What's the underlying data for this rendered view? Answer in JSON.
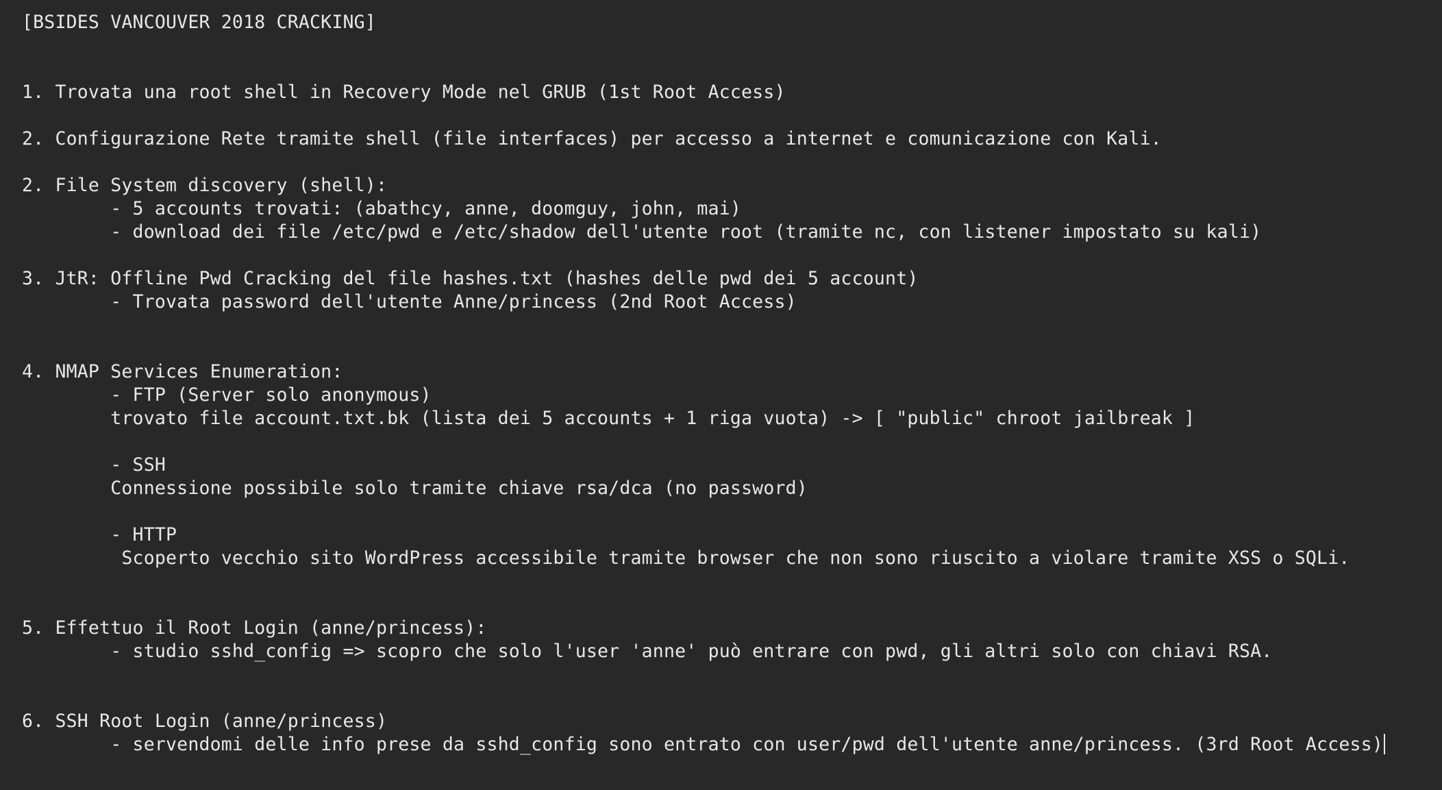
{
  "document": {
    "lines": [
      "[BSIDES VANCOUVER 2018 CRACKING]",
      "",
      "",
      "1. Trovata una root shell in Recovery Mode nel GRUB (1st Root Access)",
      "",
      "2. Configurazione Rete tramite shell (file interfaces) per accesso a internet e comunicazione con Kali.",
      "",
      "2. File System discovery (shell):",
      "        - 5 accounts trovati: (abathcy, anne, doomguy, john, mai)",
      "        - download dei file /etc/pwd e /etc/shadow dell'utente root (tramite nc, con listener impostato su kali)",
      "",
      "3. JtR: Offline Pwd Cracking del file hashes.txt (hashes delle pwd dei 5 account)",
      "        - Trovata password dell'utente Anne/princess (2nd Root Access)",
      "",
      "",
      "4. NMAP Services Enumeration:",
      "        - FTP (Server solo anonymous)",
      "        trovato file account.txt.bk (lista dei 5 accounts + 1 riga vuota) -> [ \"public\" chroot jailbreak ]",
      "",
      "        - SSH",
      "        Connessione possibile solo tramite chiave rsa/dca (no password)",
      "",
      "        - HTTP",
      "         Scoperto vecchio sito WordPress accessibile tramite browser che non sono riuscito a violare tramite XSS o SQLi.",
      "",
      "",
      "5. Effettuo il Root Login (anne/princess):",
      "        - studio sshd_config => scopro che solo l'user 'anne' può entrare con pwd, gli altri solo con chiavi RSA.",
      "",
      "",
      "6. SSH Root Login (anne/princess)",
      "        - servendomi delle info prese da sshd_config sono entrato con user/pwd dell'utente anne/princess. (3rd Root Access)"
    ]
  },
  "colors": {
    "background": "#282828",
    "text": "#e8e8e8"
  }
}
